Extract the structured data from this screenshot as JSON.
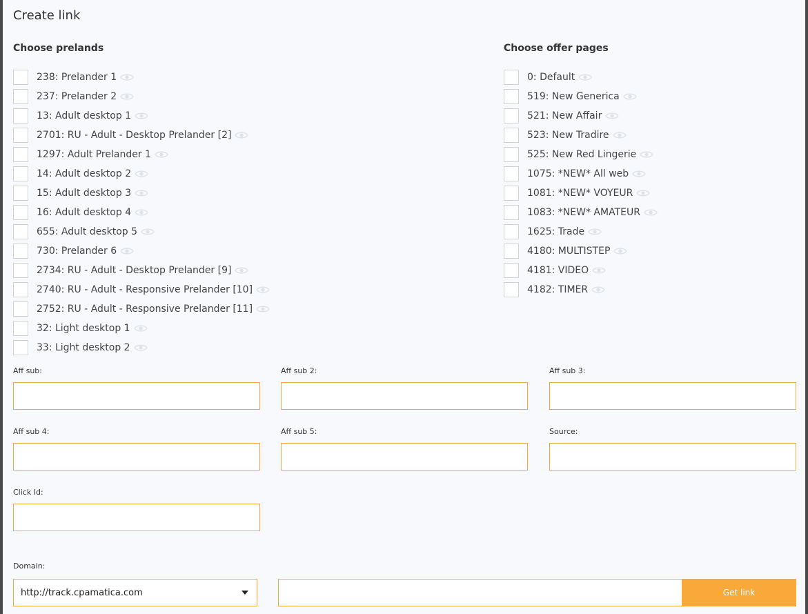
{
  "title": "Create link",
  "prelands": {
    "heading": "Choose prelands",
    "items": [
      {
        "label": "238: Prelander 1"
      },
      {
        "label": "237: Prelander 2"
      },
      {
        "label": "13: Adult desktop 1"
      },
      {
        "label": "2701: RU - Adult - Desktop Prelander [2]"
      },
      {
        "label": "1297: Adult Prelander 1"
      },
      {
        "label": "14: Adult desktop 2"
      },
      {
        "label": "15: Adult desktop 3"
      },
      {
        "label": "16: Adult desktop 4"
      },
      {
        "label": "655: Adult desktop 5"
      },
      {
        "label": "730: Prelander 6"
      },
      {
        "label": "2734: RU - Adult - Desktop Prelander [9]"
      },
      {
        "label": "2740: RU - Adult - Responsive Prelander [10]"
      },
      {
        "label": "2752: RU - Adult - Responsive Prelander [11]"
      },
      {
        "label": "32: Light desktop 1"
      },
      {
        "label": "33: Light desktop 2"
      }
    ]
  },
  "offer_pages": {
    "heading": "Choose offer pages",
    "items": [
      {
        "label": "0: Default"
      },
      {
        "label": "519: New Generica"
      },
      {
        "label": "521: New Affair"
      },
      {
        "label": "523: New Tradire"
      },
      {
        "label": "525: New Red Lingerie"
      },
      {
        "label": "1075: *NEW* All web"
      },
      {
        "label": "1081: *NEW* VOYEUR"
      },
      {
        "label": "1083: *NEW* AMATEUR"
      },
      {
        "label": "1625: Trade"
      },
      {
        "label": "4180: MULTISTEP"
      },
      {
        "label": "4181: VIDEO"
      },
      {
        "label": "4182: TIMER"
      }
    ]
  },
  "fields": {
    "aff_sub": {
      "label": "Aff sub:",
      "value": ""
    },
    "aff_sub2": {
      "label": "Aff sub 2:",
      "value": ""
    },
    "aff_sub3": {
      "label": "Aff sub 3:",
      "value": ""
    },
    "aff_sub4": {
      "label": "Aff sub 4:",
      "value": ""
    },
    "aff_sub5": {
      "label": "Aff sub 5:",
      "value": ""
    },
    "source": {
      "label": "Source:",
      "value": ""
    },
    "click_id": {
      "label": "Click Id:",
      "value": ""
    }
  },
  "domain": {
    "label": "Domain:",
    "selected": "http://track.cpamatica.com"
  },
  "get_link": {
    "label": "Get link",
    "output": ""
  },
  "colors": {
    "accent": "#f8a93a",
    "input_border": "#f2a93b",
    "background": "#f8f9fc"
  },
  "icons": {
    "preview": "eye-icon",
    "select": "caret-down-icon"
  }
}
